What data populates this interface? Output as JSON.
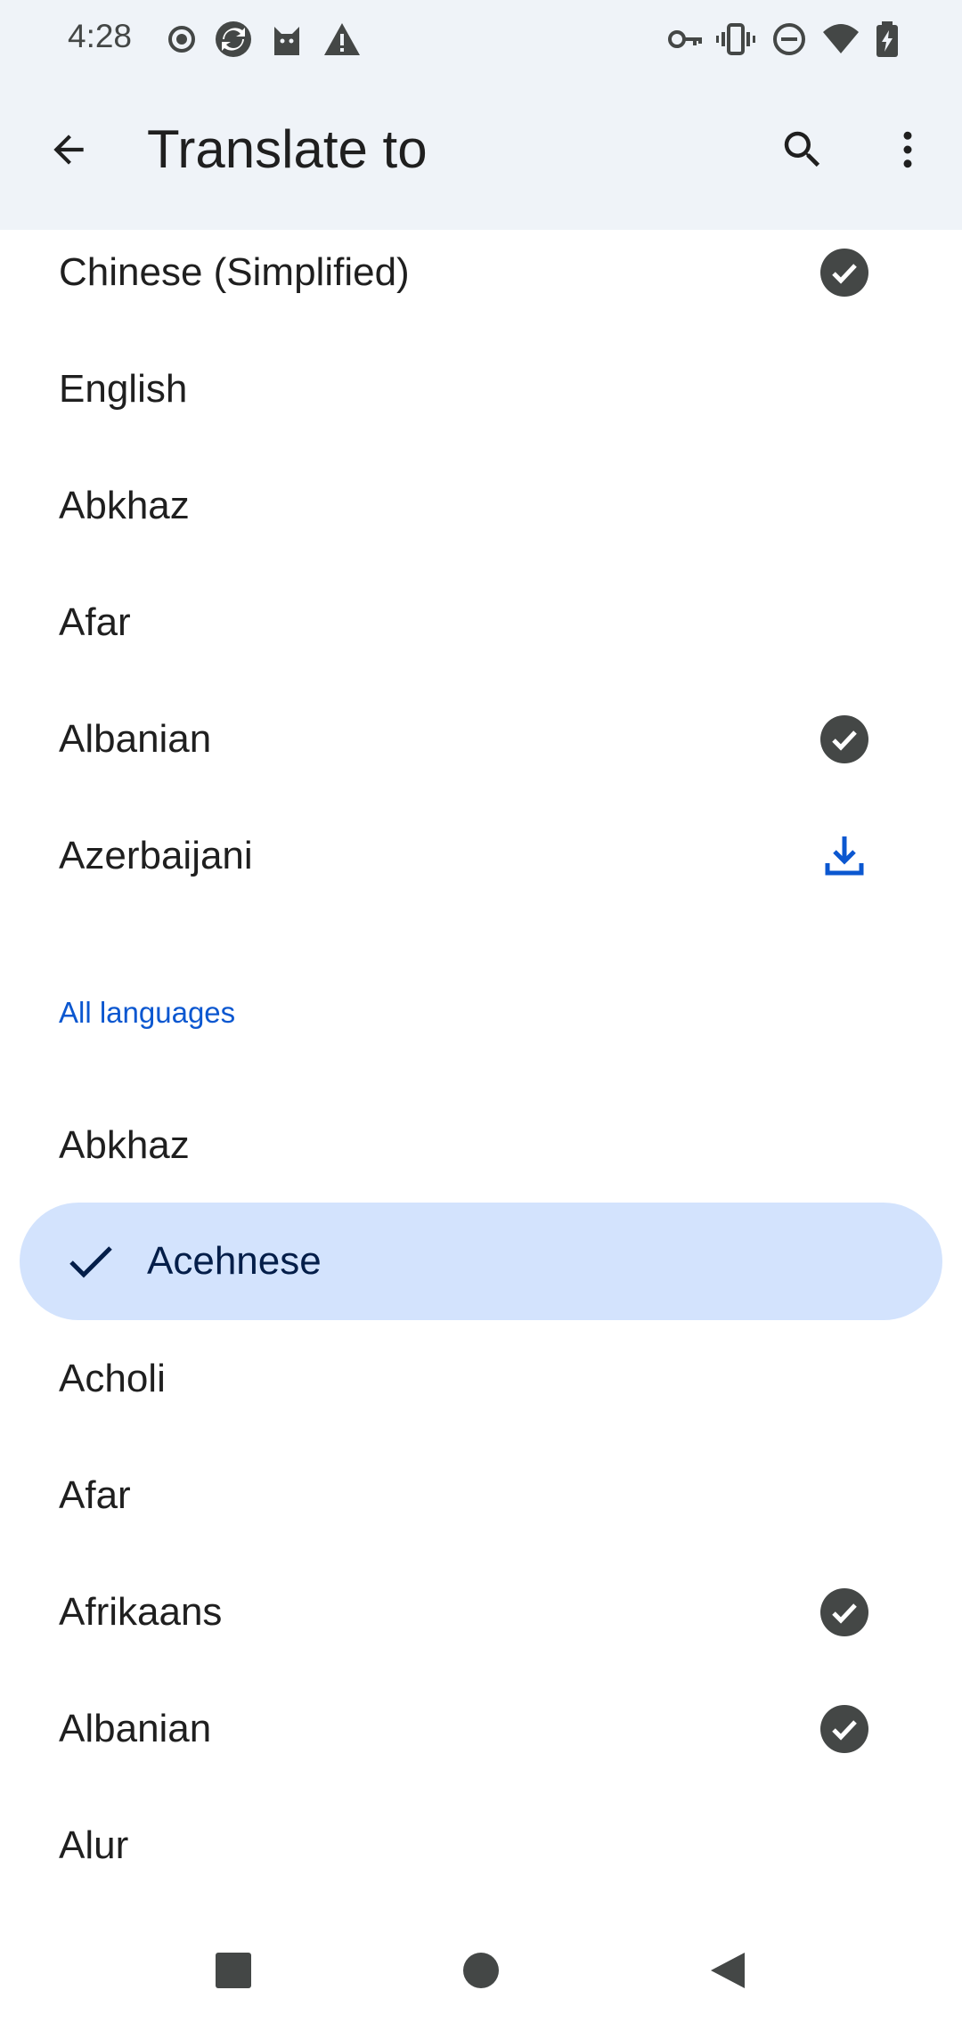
{
  "status_bar": {
    "time": "4:28",
    "left_icons": [
      "record-icon",
      "sync-icon",
      "cat-icon",
      "warning-icon"
    ],
    "right_icons": [
      "key-icon",
      "vibrate-icon",
      "do-not-disturb-icon",
      "wifi-icon",
      "battery-charging-icon"
    ]
  },
  "app_bar": {
    "title": "Translate to",
    "back_icon": "arrow-back-icon",
    "search_icon": "search-icon",
    "more_icon": "more-vert-icon"
  },
  "recent_languages": [
    {
      "label": "Chinese (Simplified)",
      "status": "downloaded"
    },
    {
      "label": "English",
      "status": "none"
    },
    {
      "label": "Abkhaz",
      "status": "none"
    },
    {
      "label": "Afar",
      "status": "none"
    },
    {
      "label": "Albanian",
      "status": "downloaded"
    },
    {
      "label": "Azerbaijani",
      "status": "download-available"
    }
  ],
  "all_languages": {
    "header": "All languages",
    "items": [
      {
        "label": "Abkhaz",
        "status": "none"
      },
      {
        "label": "Acehnese",
        "status": "none",
        "selected": true
      },
      {
        "label": "Acholi",
        "status": "none"
      },
      {
        "label": "Afar",
        "status": "none"
      },
      {
        "label": "Afrikaans",
        "status": "downloaded"
      },
      {
        "label": "Albanian",
        "status": "downloaded"
      },
      {
        "label": "Alur",
        "status": "none"
      }
    ]
  },
  "colors": {
    "app_bar_bg": "#eff3f8",
    "accent": "#0b57d0",
    "selected_bg": "#d3e3fd",
    "check_circle": "#444746"
  },
  "nav_bar": {
    "icons": [
      "recents-square-icon",
      "home-circle-icon",
      "back-triangle-icon"
    ]
  }
}
